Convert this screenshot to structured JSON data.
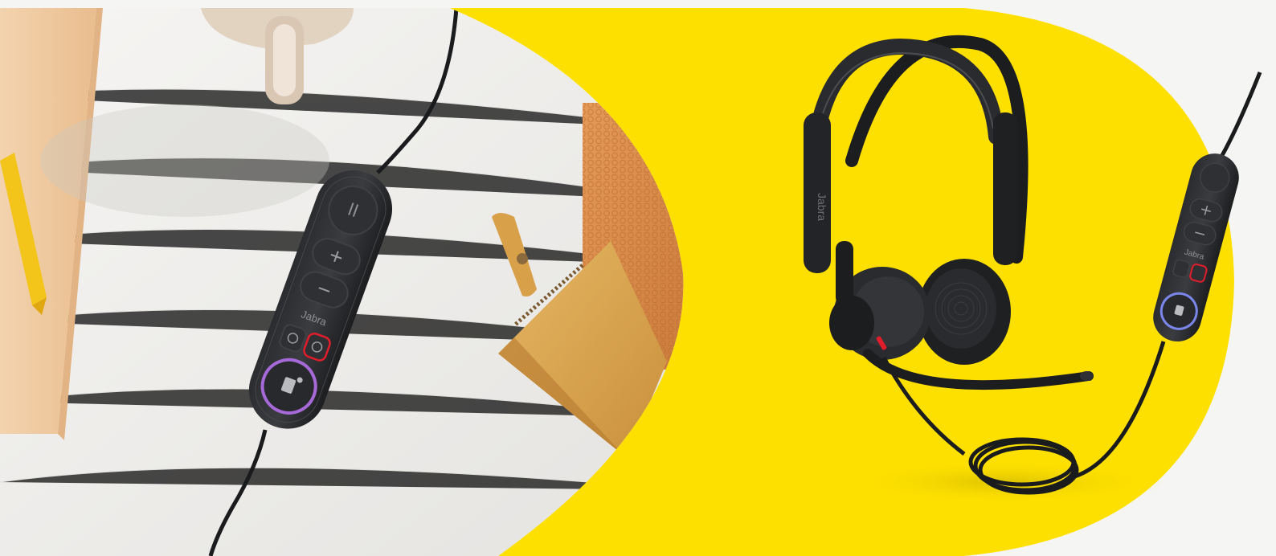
{
  "banner": {
    "brand_name": "Jabra",
    "colors": {
      "page_background": "#f5f5f3",
      "brand_yellow": "#fee000",
      "desk_white": "#efeeec",
      "notebook": "#efc9a0",
      "leather_orange": "#d98c47",
      "wallet_tan": "#d7a44d",
      "device_black": "#222426",
      "teams_ring_purple": "#a66ad8",
      "teams_ring_blue": "#7b86ea",
      "mute_red": "#e11d2c",
      "pencil_yellow": "#f3c419"
    },
    "icons": {
      "remote_mic": "microphone-icon",
      "volume_up": "plus-icon",
      "volume_down": "minus-icon",
      "teams": "teams-icon",
      "answer": "phone-icon",
      "mute": "mute-icon"
    }
  }
}
